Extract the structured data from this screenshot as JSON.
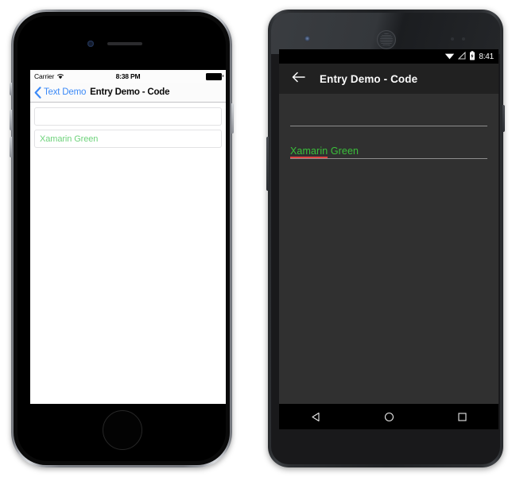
{
  "ios": {
    "status_bar": {
      "carrier": "Carrier",
      "wifi_icon": "wifi-icon",
      "time": "8:38 PM",
      "battery_icon": "battery-full-icon"
    },
    "nav_bar": {
      "back_icon": "chevron-left-icon",
      "back_label": "Text Demo",
      "title": "Entry Demo - Code"
    },
    "entries": [
      {
        "text": "",
        "placeholder": ""
      },
      {
        "text": "Xamarin Green",
        "placeholder": ""
      }
    ],
    "colors": {
      "tint": "#3c8af7",
      "entry_text_green": "#6fd37c",
      "screen_bg": "#ffffff"
    }
  },
  "android": {
    "status_bar": {
      "wifi_icon": "wifi-icon",
      "signal_icon": "signal-off-icon",
      "battery_icon": "battery-charging-icon",
      "time": "8:41"
    },
    "toolbar": {
      "back_icon": "arrow-left-icon",
      "title": "Entry Demo - Code"
    },
    "entries": [
      {
        "text": "",
        "placeholder": ""
      },
      {
        "text": "Xamarin Green",
        "misspelled_word": "Xamarin",
        "rest_word": " Green"
      }
    ],
    "nav_bar": {
      "back_icon": "triangle-back-icon",
      "home_icon": "circle-home-icon",
      "recents_icon": "square-recents-icon"
    },
    "colors": {
      "screen_bg": "#303030",
      "toolbar_bg": "#212121",
      "entry_text_green": "#3ac03a",
      "spell_underline": "#e04444"
    }
  }
}
